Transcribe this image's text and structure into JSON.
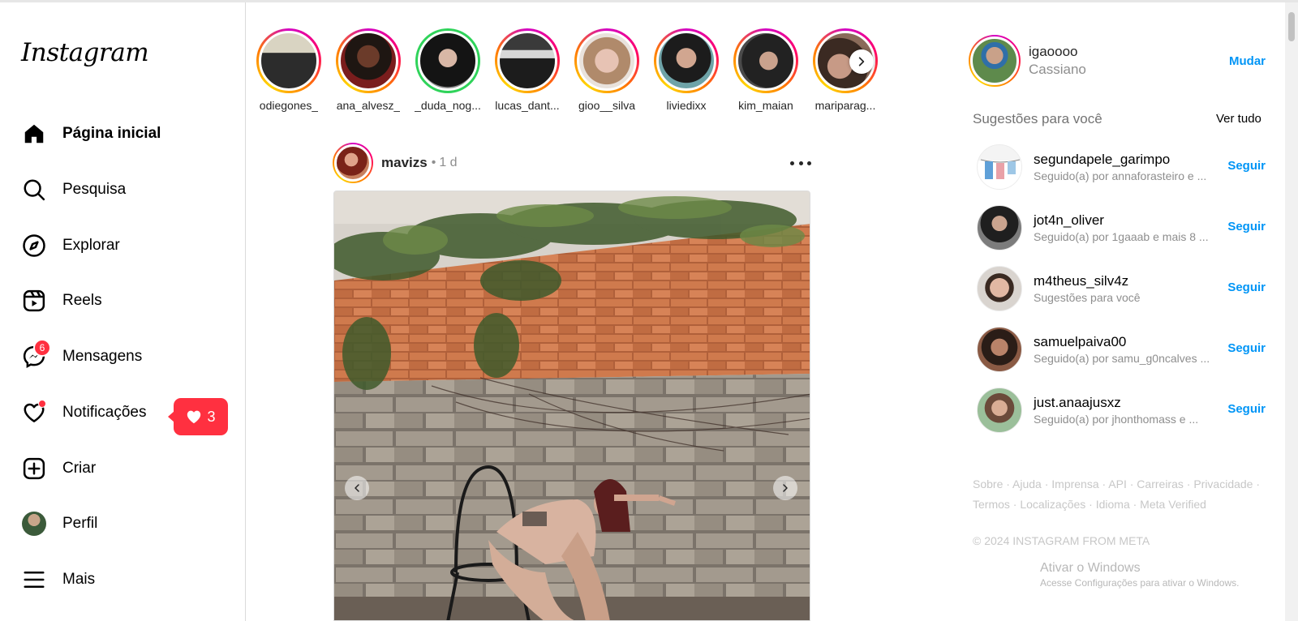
{
  "app": {
    "logo_text": "Instagram"
  },
  "sidebar": {
    "items": [
      {
        "label": "Página inicial",
        "icon": "home-icon",
        "active": true
      },
      {
        "label": "Pesquisa",
        "icon": "search-icon"
      },
      {
        "label": "Explorar",
        "icon": "compass-icon"
      },
      {
        "label": "Reels",
        "icon": "reels-icon"
      },
      {
        "label": "Mensagens",
        "icon": "messenger-icon",
        "badge": "6"
      },
      {
        "label": "Notificações",
        "icon": "heart-icon",
        "dot": true
      },
      {
        "label": "Criar",
        "icon": "plus-square-icon"
      },
      {
        "label": "Perfil",
        "icon": "profile-avatar"
      },
      {
        "label": "Mais",
        "icon": "menu-icon"
      }
    ],
    "notification_popup": {
      "icon": "heart-icon",
      "count": "3"
    }
  },
  "stories": [
    {
      "name": "odiegones_",
      "ring": "gradient"
    },
    {
      "name": "ana_alvesz_",
      "ring": "gradient"
    },
    {
      "name": "_duda_nog...",
      "ring": "green"
    },
    {
      "name": "lucas_dant...",
      "ring": "gradient"
    },
    {
      "name": "gioo__silva",
      "ring": "gradient"
    },
    {
      "name": "liviedixx",
      "ring": "gradient"
    },
    {
      "name": "kim_maian",
      "ring": "gradient"
    },
    {
      "name": "mariparag...",
      "ring": "gradient"
    }
  ],
  "post": {
    "username": "mavizs",
    "separator": "•",
    "time": "1 d"
  },
  "right": {
    "current_user": {
      "username": "igaoooo",
      "name": "Cassiano",
      "switch_label": "Mudar"
    },
    "suggestions_title": "Sugestões para você",
    "see_all": "Ver tudo",
    "suggestions": [
      {
        "username": "segundapele_garimpo",
        "subtitle": "Seguido(a) por annaforasteiro e ...",
        "action": "Seguir"
      },
      {
        "username": "jot4n_oliver",
        "subtitle": "Seguido(a) por 1gaaab e mais 8 ...",
        "action": "Seguir"
      },
      {
        "username": "m4theus_silv4z",
        "subtitle": "Sugestões para você",
        "action": "Seguir"
      },
      {
        "username": "samuelpaiva00",
        "subtitle": "Seguido(a) por samu_g0ncalves ...",
        "action": "Seguir"
      },
      {
        "username": "just.anaajusxz",
        "subtitle": "Seguido(a) por jhonthomass e ...",
        "action": "Seguir"
      }
    ],
    "footer_line1": "Sobre · Ajuda · Imprensa · API · Carreiras · Privacidade ·",
    "footer_line2": "Termos · Localizações · Idioma · Meta Verified",
    "copyright": "© 2024 INSTAGRAM FROM META"
  },
  "windows_watermark": {
    "title": "Ativar o Windows",
    "subtitle": "Acesse Configurações para ativar o Windows."
  },
  "colors": {
    "link": "#0095f6",
    "badge": "#ff3040",
    "muted": "#8e8e8e"
  }
}
